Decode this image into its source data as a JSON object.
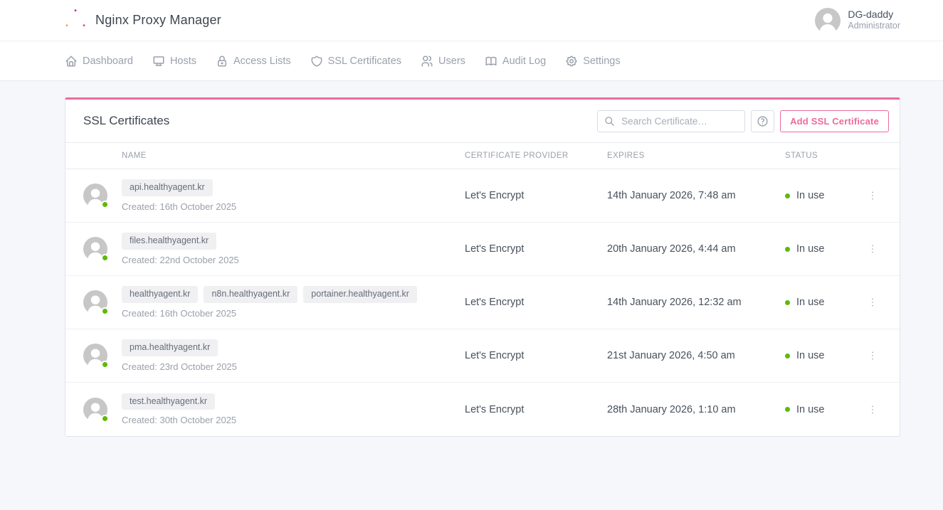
{
  "colors": {
    "accent_pink": "#ec6b9c",
    "status_green": "#5eba00"
  },
  "header": {
    "app_title": "Nginx Proxy Manager",
    "user": {
      "name": "DG-daddy",
      "role": "Administrator"
    }
  },
  "nav": {
    "items": [
      {
        "label": "Dashboard",
        "icon": "home-icon"
      },
      {
        "label": "Hosts",
        "icon": "monitor-icon"
      },
      {
        "label": "Access Lists",
        "icon": "lock-icon"
      },
      {
        "label": "SSL Certificates",
        "icon": "shield-icon"
      },
      {
        "label": "Users",
        "icon": "users-icon"
      },
      {
        "label": "Audit Log",
        "icon": "book-icon"
      },
      {
        "label": "Settings",
        "icon": "gear-icon"
      }
    ]
  },
  "card": {
    "title": "SSL Certificates",
    "search_placeholder": "Search Certificate…",
    "add_button": "Add SSL Certificate"
  },
  "table": {
    "headers": [
      "NAME",
      "CERTIFICATE PROVIDER",
      "EXPIRES",
      "STATUS"
    ],
    "rows": [
      {
        "domains": [
          "api.healthyagent.kr"
        ],
        "created": "Created: 16th October 2025",
        "provider": "Let's Encrypt",
        "expires": "14th January 2026, 7:48 am",
        "status": "In use"
      },
      {
        "domains": [
          "files.healthyagent.kr"
        ],
        "created": "Created: 22nd October 2025",
        "provider": "Let's Encrypt",
        "expires": "20th January 2026, 4:44 am",
        "status": "In use"
      },
      {
        "domains": [
          "healthyagent.kr",
          "n8n.healthyagent.kr",
          "portainer.healthyagent.kr"
        ],
        "created": "Created: 16th October 2025",
        "provider": "Let's Encrypt",
        "expires": "14th January 2026, 12:32 am",
        "status": "In use"
      },
      {
        "domains": [
          "pma.healthyagent.kr"
        ],
        "created": "Created: 23rd October 2025",
        "provider": "Let's Encrypt",
        "expires": "21st January 2026, 4:50 am",
        "status": "In use"
      },
      {
        "domains": [
          "test.healthyagent.kr"
        ],
        "created": "Created: 30th October 2025",
        "provider": "Let's Encrypt",
        "expires": "28th January 2026, 1:10 am",
        "status": "In use"
      }
    ]
  }
}
